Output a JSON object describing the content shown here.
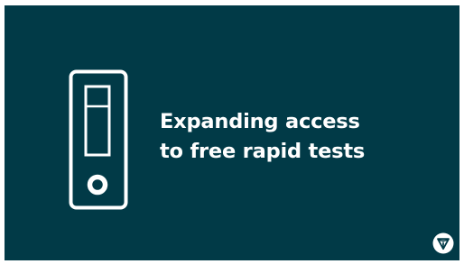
{
  "banner": {
    "background_color": "#013a47",
    "foreground_color": "#ffffff",
    "headline_line1": "Expanding access",
    "headline_line2": "to free rapid tests",
    "illustration_icon": "rapid-test-cassette-icon",
    "logo_icon": "ontario-trillium-logo-icon"
  }
}
